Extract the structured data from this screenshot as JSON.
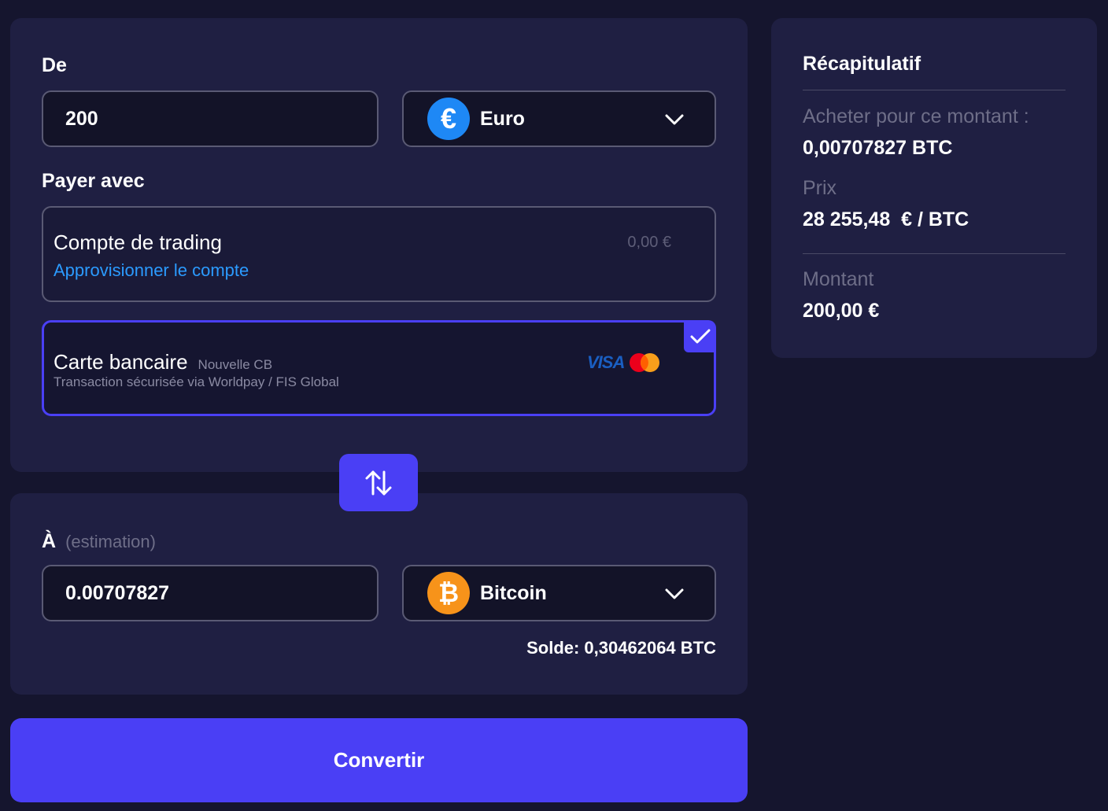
{
  "from": {
    "label": "De",
    "amount": "200",
    "currency": {
      "name": "Euro",
      "symbol": "€",
      "color": "#1e88f5"
    }
  },
  "pay_with": {
    "label": "Payer avec",
    "trading": {
      "title": "Compte de trading",
      "link": "Approvisionner le compte",
      "balance": "0,00 €"
    },
    "card": {
      "title": "Carte bancaire",
      "tag": "Nouvelle CB",
      "subtitle": "Transaction sécurisée via Worldpay / FIS Global",
      "brand": "VISA",
      "selected": true
    }
  },
  "to": {
    "label": "À",
    "hint": "(estimation)",
    "amount": "0.00707827",
    "currency": {
      "name": "Bitcoin",
      "symbol": "₿",
      "color": "#f7931a"
    },
    "balance": "Solde: 0,30462064 BTC"
  },
  "convert_label": "Convertir",
  "summary": {
    "title": "Récapitulatif",
    "buy_label": "Acheter pour ce montant :",
    "buy_value": "0,00707827 BTC",
    "price_label": "Prix",
    "price_value": "28 255,48  € / BTC",
    "amount_label": "Montant",
    "amount_value": "200,00 €"
  },
  "colors": {
    "accent": "#4a3ff5",
    "link": "#2b9bff",
    "background": "#15152e",
    "card": "#1f1f42"
  }
}
